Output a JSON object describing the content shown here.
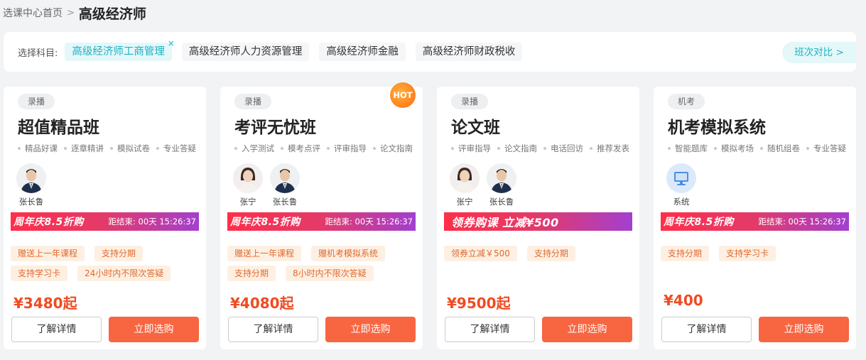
{
  "breadcrumb": {
    "home": "选课中心首页",
    "separator": ">",
    "current": "高级经济师"
  },
  "subjects": {
    "label": "选择科目:",
    "items": [
      {
        "label": "高级经济师工商管理",
        "active": true,
        "close": "×"
      },
      {
        "label": "高级经济师人力资源管理"
      },
      {
        "label": "高级经济师金融"
      },
      {
        "label": "高级经济师财政税收"
      }
    ],
    "compare": "班次对比 >"
  },
  "cards": [
    {
      "type": "录播",
      "title": "超值精品班",
      "features": [
        "精品好课",
        "逐章精讲",
        "模拟试卷",
        "专业答疑"
      ],
      "teachers": [
        {
          "name": "张长鲁"
        }
      ],
      "promo": {
        "title": "周年庆8.5折购",
        "countdown": "距结束: 00天 15:26:37"
      },
      "perks": [
        "赠送上一年课程",
        "支持分期",
        "支持学习卡",
        "24小时内不限次答疑"
      ],
      "price": "¥3480起",
      "detail": "了解详情",
      "buy": "立即选购"
    },
    {
      "type": "录播",
      "title": "考评无忧班",
      "hot": "HOT",
      "features": [
        "入学测试",
        "模考点评",
        "评审指导",
        "论文指南"
      ],
      "teachers": [
        {
          "name": "张宁"
        },
        {
          "name": "张长鲁"
        }
      ],
      "promo": {
        "title": "周年庆8.5折购",
        "countdown": "距结束: 00天 15:26:37"
      },
      "perks": [
        "赠送上一年课程",
        "赠机考模拟系统",
        "支持分期",
        "8小时内不限次答疑"
      ],
      "price": "¥4080起",
      "detail": "了解详情",
      "buy": "立即选购"
    },
    {
      "type": "录播",
      "title": "论文班",
      "features": [
        "评审指导",
        "论文指南",
        "电话回访",
        "推荐发表"
      ],
      "teachers": [
        {
          "name": "张宁"
        },
        {
          "name": "张长鲁"
        }
      ],
      "promo": {
        "title": "领券购课 立减¥500"
      },
      "perks": [
        "领券立减￥500",
        "支持分期"
      ],
      "price": "¥9500起",
      "detail": "了解详情",
      "buy": "立即选购"
    },
    {
      "type": "机考",
      "title": "机考模拟系统",
      "features": [
        "智能题库",
        "模拟考场",
        "随机组卷",
        "专业答疑"
      ],
      "teachers": [
        {
          "name": "系统",
          "icon": "monitor-icon"
        }
      ],
      "promo": {
        "title": "周年庆8.5折购",
        "countdown": "距结束: 00天 15:26:37"
      },
      "perks": [
        "支持分期",
        "支持学习卡"
      ],
      "price": "¥400",
      "detail": "了解详情",
      "buy": "立即选购"
    }
  ],
  "colors": {
    "accent": "#1bb3c2",
    "price": "#f04b22",
    "buy_button": "#f86541",
    "perk_text": "#e2692f"
  }
}
